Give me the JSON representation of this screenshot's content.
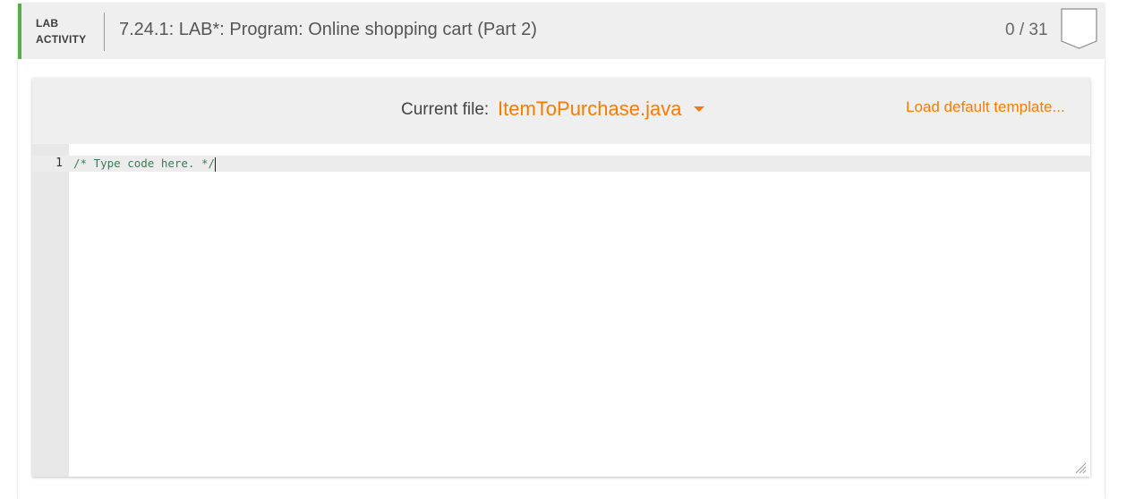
{
  "header": {
    "tag_line1": "LAB",
    "tag_line2": "ACTIVITY",
    "title": "7.24.1: LAB*: Program: Online shopping cart (Part 2)",
    "score": "0 / 31",
    "accent_color": "#5aac4b"
  },
  "editor": {
    "current_file_label": "Current file:",
    "current_file": "ItemToPurchase.java",
    "load_default_label": "Load default template...",
    "accent_color": "#f57c00",
    "lines": [
      {
        "number": "1",
        "text": "/* Type code here. */"
      }
    ]
  },
  "icons": {
    "badge": "completion-badge-icon",
    "dropdown": "chevron-down-icon",
    "resize": "resize-handle-icon"
  }
}
